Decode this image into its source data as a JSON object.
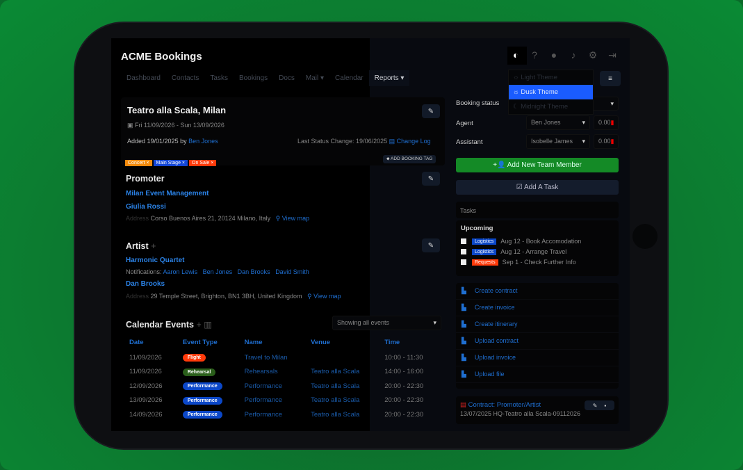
{
  "app": {
    "title": "ACME Bookings"
  },
  "nav": [
    "Dashboard",
    "Contacts",
    "Tasks",
    "Bookings",
    "Docs",
    "Mail ▾",
    "Calendar",
    "Reports ▾"
  ],
  "header_icons": [
    "theme-icon",
    "help-icon",
    "user-icon",
    "bell-icon",
    "gear-icon",
    "logout-icon"
  ],
  "theme_menu": [
    "Light Theme",
    "Dusk Theme",
    "Midnight Theme"
  ],
  "booking": {
    "title": "Teatro alla Scala, Milan",
    "dates": "Fri 11/09/2026 - Sun 13/09/2026",
    "added": "Added 19/01/2025 by",
    "added_by": "Ben Jones",
    "last_status": "Last Status Change: 19/06/2025",
    "change_log": "Change Log",
    "tags": [
      {
        "label": "Concert ×",
        "color": "#f28a0c"
      },
      {
        "label": "Main Stage ×",
        "color": "#1346d6"
      },
      {
        "label": "On Sale ×",
        "color": "#ff3a0a"
      }
    ],
    "add_tag": "ADD BOOKING TAG"
  },
  "promoter": {
    "heading": "Promoter",
    "company": "Milan Event Management",
    "contact": "Giulia Rossi",
    "address_label": "Address",
    "address": "Corso Buenos Aires 21, 20124 Milano, Italy",
    "map": "View map"
  },
  "artist": {
    "heading": "Artist",
    "name": "Harmonic Quartet",
    "notif_label": "Notifications:",
    "notifications": [
      "Aaron Lewis",
      "Ben Jones",
      "Dan Brooks",
      "David Smith"
    ],
    "contact": "Dan Brooks",
    "address_label": "Address",
    "address": "29 Temple Street, Brighton, BN1 3BH, United Kingdom",
    "map": "View map"
  },
  "calendar": {
    "heading": "Calendar Events",
    "filter": "Showing all events",
    "columns": [
      "Date",
      "Event Type",
      "Name",
      "Venue",
      "Time"
    ],
    "rows": [
      {
        "date": "11/09/2026",
        "type": "Flight",
        "color": "#ff3a0a",
        "name": "Travel to Milan",
        "venue": "",
        "time": "10:00 - 11:30"
      },
      {
        "date": "11/09/2026",
        "type": "Rehearsal",
        "color": "#2a5e1a",
        "name": "Rehearsals",
        "venue": "Teatro alla Scala",
        "time": "14:00 - 16:00"
      },
      {
        "date": "12/09/2026",
        "type": "Performance",
        "color": "#0b47c8",
        "name": "Performance",
        "venue": "Teatro alla Scala",
        "time": "20:00 - 22:30"
      },
      {
        "date": "13/09/2026",
        "type": "Performance",
        "color": "#0b47c8",
        "name": "Performance",
        "venue": "Teatro alla Scala",
        "time": "20:00 - 22:30"
      },
      {
        "date": "14/09/2026",
        "type": "Performance",
        "color": "#0b47c8",
        "name": "Performance",
        "venue": "Teatro alla Scala",
        "time": "20:00 - 22:30"
      }
    ]
  },
  "side": {
    "status_label": "Booking status",
    "agent_label": "Agent",
    "agent": "Ben Jones",
    "agent_fee": "0.00",
    "assistant_label": "Assistant",
    "assistant": "Isobelle James",
    "assistant_fee": "0.00",
    "add_member": "Add New Team Member",
    "add_task": "Add A Task"
  },
  "tasks": {
    "heading": "Tasks",
    "subheading": "Upcoming",
    "items": [
      {
        "tag": "Logistics",
        "color": "#0b47c8",
        "text": "Aug 12 - Book Accomodation"
      },
      {
        "tag": "Logistics",
        "color": "#0b47c8",
        "text": "Aug 12 - Arrange Travel"
      },
      {
        "tag": "Requests",
        "color": "#ff3a0a",
        "text": "Sep 1 - Check Further Info"
      }
    ]
  },
  "docs": [
    "Create contract",
    "Create invoice",
    "Create itinerary",
    "Upload contract",
    "Upload invoice",
    "Upload file"
  ],
  "contract": {
    "title": "Contract: Promoter/Artist",
    "meta": "13/07/2025 HQ-Teatro alla Scala-09112026"
  }
}
